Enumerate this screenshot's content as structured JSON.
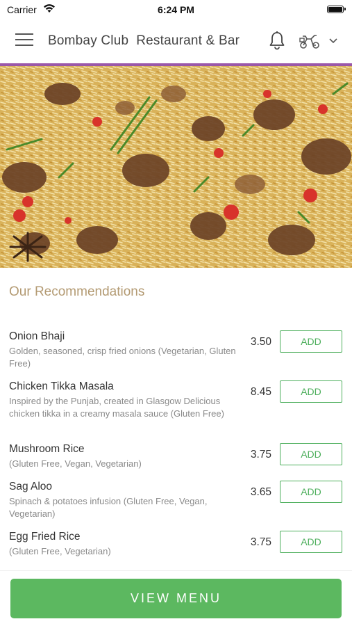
{
  "status_bar": {
    "carrier": "Carrier",
    "time": "6:24 PM"
  },
  "header": {
    "title": "Bombay Club  Restaurant & Bar"
  },
  "hero": {
    "image_icon": "biryani-photo"
  },
  "section": {
    "title": "Our Recommendations"
  },
  "items": [
    {
      "name": "Onion Bhaji",
      "description": "Golden, seasoned, crisp fried onions (Vegetarian, Gluten Free)",
      "price": "3.50",
      "add_label": "ADD"
    },
    {
      "name": "Chicken Tikka Masala",
      "description": "Inspired by the Punjab, created in Glasgow Delicious chicken tikka in a creamy masala sauce (Gluten Free)",
      "price": "8.45",
      "add_label": "ADD"
    },
    {
      "name": "Mushroom Rice",
      "description": "(Gluten Free, Vegan, Vegetarian)",
      "price": "3.75",
      "add_label": "ADD"
    },
    {
      "name": "Sag Aloo",
      "description": "Spinach & potatoes infusion (Gluten Free, Vegan, Vegetarian)",
      "price": "3.65",
      "add_label": "ADD"
    },
    {
      "name": "Egg Fried Rice",
      "description": "(Gluten Free, Vegetarian)",
      "price": "3.75",
      "add_label": "ADD"
    }
  ],
  "footer": {
    "view_menu_label": "VIEW MENU"
  },
  "colors": {
    "accent_green": "#5cb860",
    "header_line": "#9a58a9",
    "section_title": "#b39a72"
  }
}
